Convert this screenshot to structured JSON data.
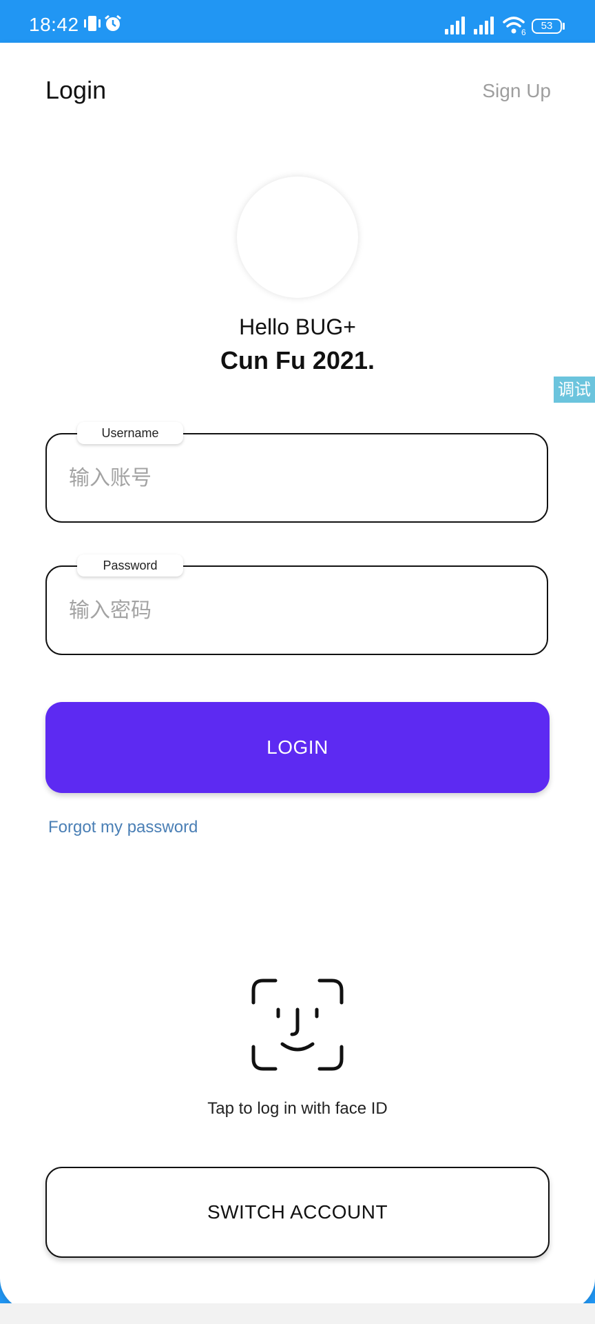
{
  "status_bar": {
    "time": "18:42",
    "battery": "53",
    "wifi_sub": "6",
    "icons": [
      "vibrate-icon",
      "alarm-icon",
      "signal-icon",
      "signal-icon",
      "wifi-icon",
      "battery-icon"
    ]
  },
  "header": {
    "title": "Login",
    "signup_label": "Sign Up"
  },
  "greeting": {
    "line1": "Hello BUG+",
    "line2": "Cun Fu 2021."
  },
  "debug_tab": "调试",
  "form": {
    "username": {
      "label": "Username",
      "placeholder": "输入账号",
      "value": ""
    },
    "password": {
      "label": "Password",
      "placeholder": "输入密码",
      "value": ""
    },
    "login_label": "LOGIN",
    "forgot_label": "Forgot my password"
  },
  "face_id": {
    "icon": "face-id-icon",
    "caption": "Tap to log in with face ID"
  },
  "switch_account_label": "SWITCH ACCOUNT",
  "colors": {
    "status_bar": "#2196f3",
    "primary_button": "#5d2af2",
    "link": "#4a7fb5",
    "muted": "#9e9e9e"
  }
}
